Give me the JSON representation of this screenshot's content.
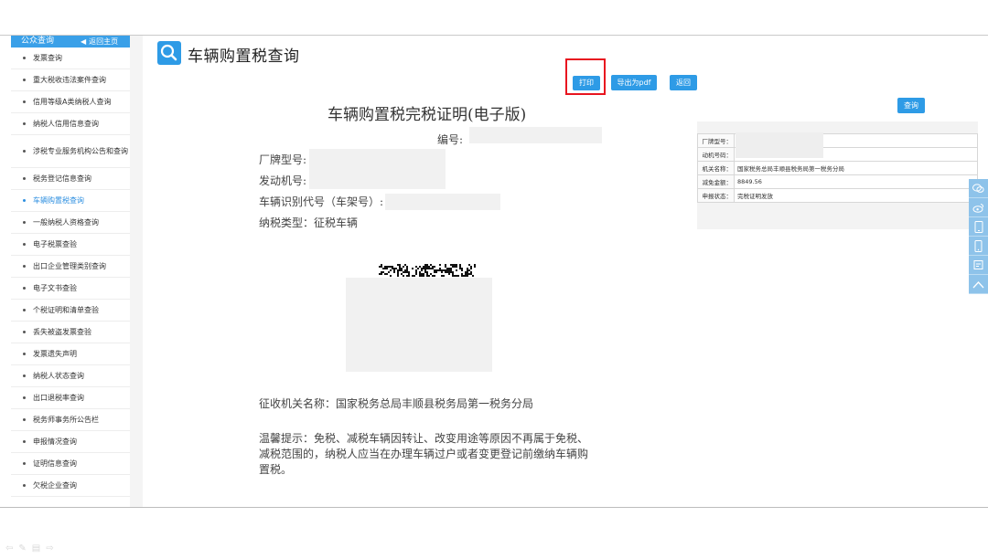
{
  "sidebar": {
    "title": "公众查询",
    "home_label": "返回主页",
    "items": [
      {
        "label": "发票查询",
        "active": false
      },
      {
        "label": "重大税收违法案件查询",
        "active": false
      },
      {
        "label": "信用等级A类纳税人查询",
        "active": false
      },
      {
        "label": "纳税人信用信息查询",
        "active": false
      },
      {
        "label": "涉税专业服务机构公告和查询",
        "active": false
      },
      {
        "label": "税务登记信息查询",
        "active": false
      },
      {
        "label": "车辆购置税查询",
        "active": true
      },
      {
        "label": "一般纳税人资格查询",
        "active": false
      },
      {
        "label": "电子税票查验",
        "active": false
      },
      {
        "label": "出口企业管理类别查询",
        "active": false
      },
      {
        "label": "电子文书查验",
        "active": false
      },
      {
        "label": "个税证明和清单查验",
        "active": false
      },
      {
        "label": "丢失被盗发票查验",
        "active": false
      },
      {
        "label": "发票遗失声明",
        "active": false
      },
      {
        "label": "纳税人状态查询",
        "active": false
      },
      {
        "label": "出口退税率查询",
        "active": false
      },
      {
        "label": "税务师事务所公告栏",
        "active": false
      },
      {
        "label": "申报情况查询",
        "active": false
      },
      {
        "label": "证明信息查询",
        "active": false
      },
      {
        "label": "欠税企业查询",
        "active": false
      }
    ]
  },
  "header": {
    "title": "车辆购置税查询"
  },
  "toolbar": {
    "print": "打印",
    "export_pdf": "导出为pdf",
    "back": "返回",
    "query": "查询"
  },
  "certificate": {
    "title": "车辆购置税完税证明(电子版)",
    "number_label": "编号:",
    "brand_label": "厂牌型号:",
    "engine_label": "发动机号:",
    "vin_label": "车辆识别代号（车架号）:",
    "tax_type": "纳税类型：征税车辆",
    "authority": "征收机关名称：国家税务总局丰顺县税务局第一税务分局",
    "tip_line1": "温馨提示：免税、减税车辆因转让、改变用途等原因不再属于免税、",
    "tip_line2": "减税范围的，纳税人应当在办理车辆过户或者变更登记前缴纳车辆购",
    "tip_line3": "置税。"
  },
  "info_table": {
    "rows": [
      {
        "key": "厂牌型号：",
        "value": ""
      },
      {
        "key": "动机号码：",
        "value": ""
      },
      {
        "key": "机关名称：",
        "value": "国家税务总局丰顺县税务局第一税务分局"
      },
      {
        "key": "减免金额：",
        "value": "8849.56"
      },
      {
        "key": "申报状态：",
        "value": "完税证明发放"
      }
    ]
  }
}
